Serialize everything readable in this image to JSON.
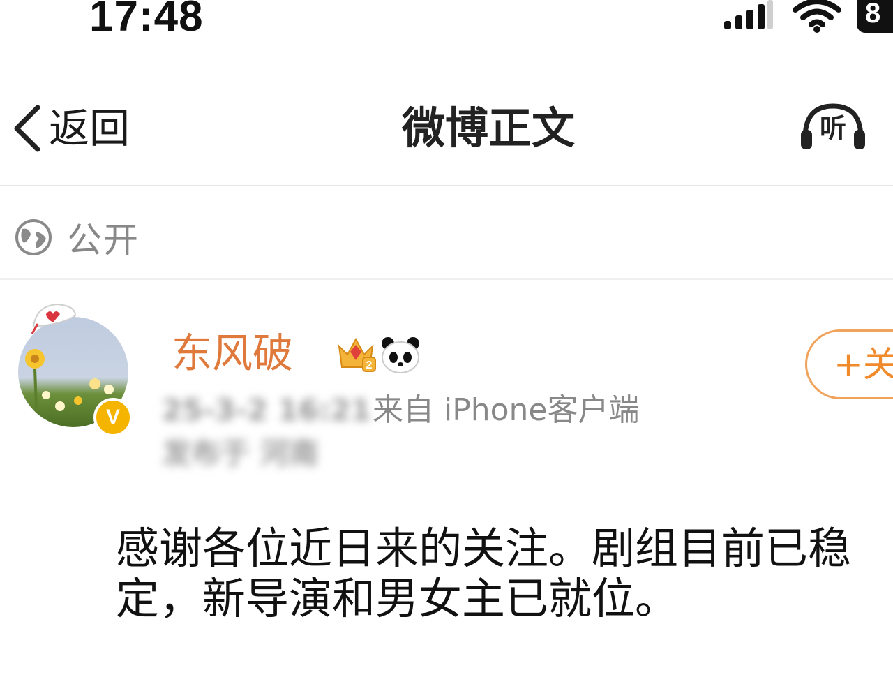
{
  "status_bar": {
    "time": "17:48",
    "battery": "8",
    "signal_icon": "cellular-signal-icon",
    "wifi_icon": "wifi-icon"
  },
  "nav": {
    "back_label": "返回",
    "title": "微博正文",
    "listen_label": "听"
  },
  "visibility": {
    "icon": "globe-icon",
    "label": "公开"
  },
  "author": {
    "name": "东风破",
    "verified_mark": "V",
    "badges": [
      "crown-level-icon",
      "panda-icon"
    ],
    "follow_label": "+关注",
    "time": "25-3-2 16:21",
    "source": "来自 iPhone客户端",
    "location": "发布于 河南"
  },
  "post": {
    "text": "感谢各位近日来的关注。剧组目前已稳定，新导演和男女主已就位。"
  },
  "colors": {
    "author_name": "#e07a3c",
    "follow": "#f08a2a",
    "verify_badge": "#f4b400"
  }
}
